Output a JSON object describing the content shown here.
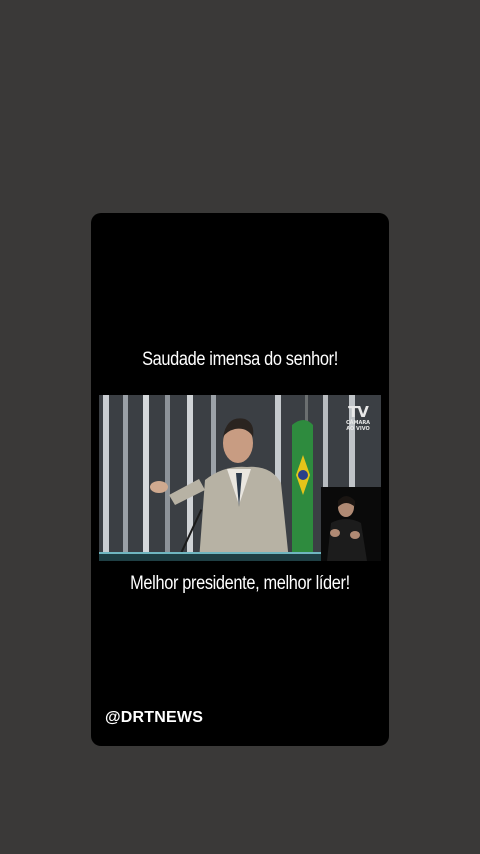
{
  "story": {
    "caption_top": "Saudade imensa do senhor!",
    "caption_bottom": "Melhor presidente, melhor líder!",
    "watermark": "@DRTNEWS"
  },
  "video": {
    "channel_logo": {
      "mark": "TV",
      "line1": "CÂMARA",
      "line2": "AO VIVO"
    }
  },
  "colors": {
    "page_background": "#3a3938",
    "card_background": "#000000",
    "text": "#ffffff"
  }
}
